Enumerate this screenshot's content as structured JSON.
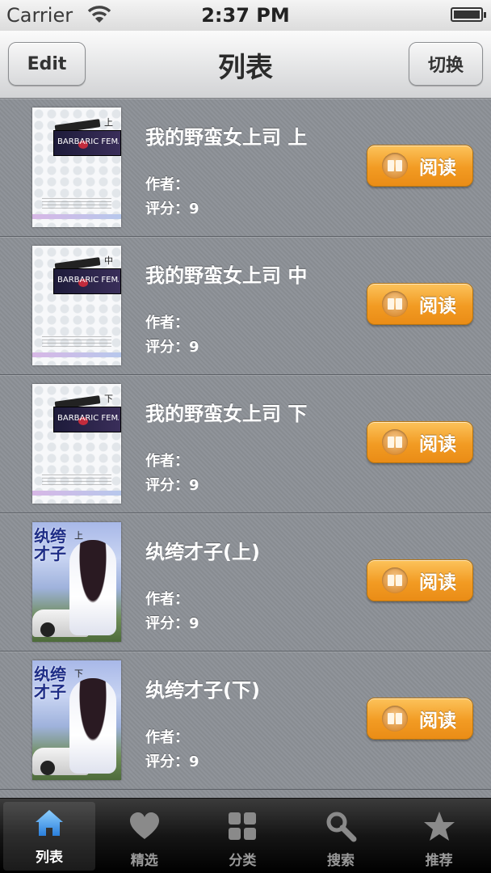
{
  "status_bar": {
    "carrier": "Carrier",
    "time": "2:37 PM"
  },
  "nav": {
    "edit_label": "Edit",
    "title": "列表",
    "switch_label": "切换"
  },
  "books": [
    {
      "title": "我的野蛮女上司 上",
      "author": "作者：",
      "rating": "评分：9",
      "cover_vol": "上",
      "cover_text": "BARBARIC FEMALE BOSS",
      "read_label": "阅读"
    },
    {
      "title": "我的野蛮女上司 中",
      "author": "作者：",
      "rating": "评分：9",
      "cover_vol": "中",
      "cover_text": "BARBARIC FEMALE BOSS",
      "read_label": "阅读"
    },
    {
      "title": "我的野蛮女上司 下",
      "author": "作者：",
      "rating": "评分：9",
      "cover_vol": "下",
      "cover_text": "BARBARIC FEMALE BOSS",
      "read_label": "阅读"
    },
    {
      "title": "纨绔才子(上)",
      "author": "作者：",
      "rating": "评分：9",
      "cover_vol": "上",
      "cover_text": "纨绔才子",
      "read_label": "阅读"
    },
    {
      "title": "纨绔才子(下)",
      "author": "作者：",
      "rating": "评分：9",
      "cover_vol": "下",
      "cover_text": "纨绔才子",
      "read_label": "阅读"
    }
  ],
  "tabs": [
    {
      "label": "列表",
      "icon": "home-icon"
    },
    {
      "label": "精选",
      "icon": "heart-icon"
    },
    {
      "label": "分类",
      "icon": "grid-icon"
    },
    {
      "label": "搜索",
      "icon": "search-icon"
    },
    {
      "label": "推荐",
      "icon": "star-icon"
    }
  ],
  "colors": {
    "read_button": "#f29b23",
    "active_tab_icon": "#2f8fe6"
  }
}
